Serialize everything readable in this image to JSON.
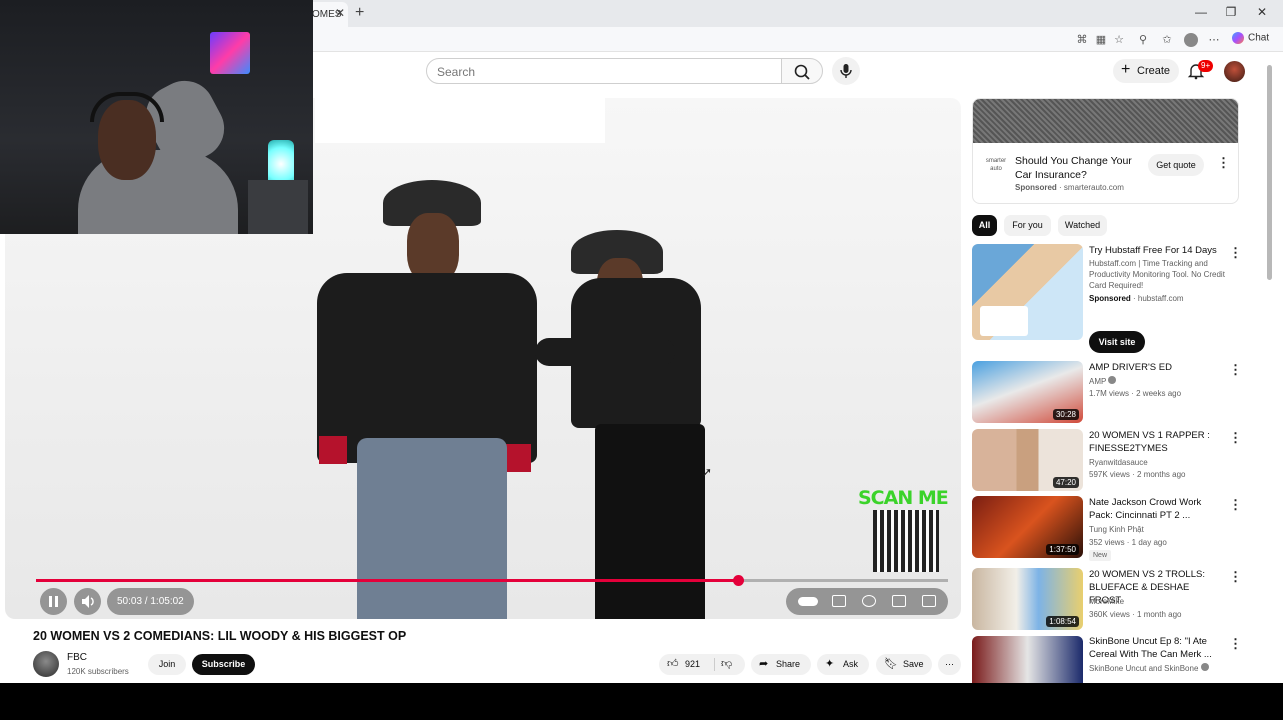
{
  "browser": {
    "tab_label": "OMES",
    "tab_close": "✕",
    "new_tab": "+",
    "minimize": "—",
    "restore": "❐",
    "close": "✕",
    "chat_label": "Chat"
  },
  "header": {
    "search_placeholder": "Search",
    "create_label": "Create",
    "notif_badge": "9+"
  },
  "player": {
    "time": "50:03 / 1:05:02",
    "progress": 0.77,
    "scan_label": "SCAN ME"
  },
  "video": {
    "title": "20 WOMEN VS 2 COMEDIANS: LIL WOODY & HIS BIGGEST OP",
    "channel": "FBC",
    "subscribers": "120K subscribers",
    "join_label": "Join",
    "subscribe_label": "Subscribe",
    "likes": "921",
    "share_label": "Share",
    "ask_label": "Ask",
    "save_label": "Save"
  },
  "ad": {
    "logo_text": "smarter auto",
    "title": "Should You Change Your Car Insurance?",
    "sponsored": "Sponsored",
    "domain": "· smarterauto.com",
    "cta": "Get quote"
  },
  "chips": [
    "All",
    "For you",
    "Watched"
  ],
  "promo": {
    "title": "Try Hubstaff Free For 14 Days",
    "desc": "Hubstaff.com | Time Tracking and Productivity Monitoring Tool. No Credit Card Required!",
    "sponsored": "Sponsored",
    "domain": "· hubstaff.com",
    "cta": "Visit site"
  },
  "recommendations": [
    {
      "title": "AMP DRIVER'S ED",
      "channel": "AMP",
      "verified": true,
      "meta": "1.7M views · 2 weeks ago",
      "duration": "30:28",
      "badge": ""
    },
    {
      "title": "20 WOMEN VS 1 RAPPER : FINESSE2TYMES",
      "channel": "Ryanwitdasauce",
      "verified": false,
      "meta": "597K views · 2 months ago",
      "duration": "47:20",
      "badge": ""
    },
    {
      "title": "Nate Jackson Crowd Work Pack: Cincinnati PT 2 ...",
      "channel": "Tung Kinh Phật",
      "verified": false,
      "meta": "352 views · 1 day ago",
      "duration": "1:37:50",
      "badge": "New"
    },
    {
      "title": "20 WOMEN VS 2 TROLLS: BLUEFACE & DESHAE FROST",
      "channel": "MoreMike",
      "verified": false,
      "meta": "360K views · 1 month ago",
      "duration": "1:08:54",
      "badge": ""
    },
    {
      "title": "SkinBone Uncut Ep 8: \"I Ate Cereal With The Can Merk ...",
      "channel": "SkinBone Uncut and SkinBone",
      "verified": true,
      "meta": "",
      "duration": "",
      "badge": ""
    }
  ],
  "colors": {
    "progress": "#e4003a",
    "subscribe_bg": "#0f0f0f",
    "scan_green": "#3bd32a"
  }
}
